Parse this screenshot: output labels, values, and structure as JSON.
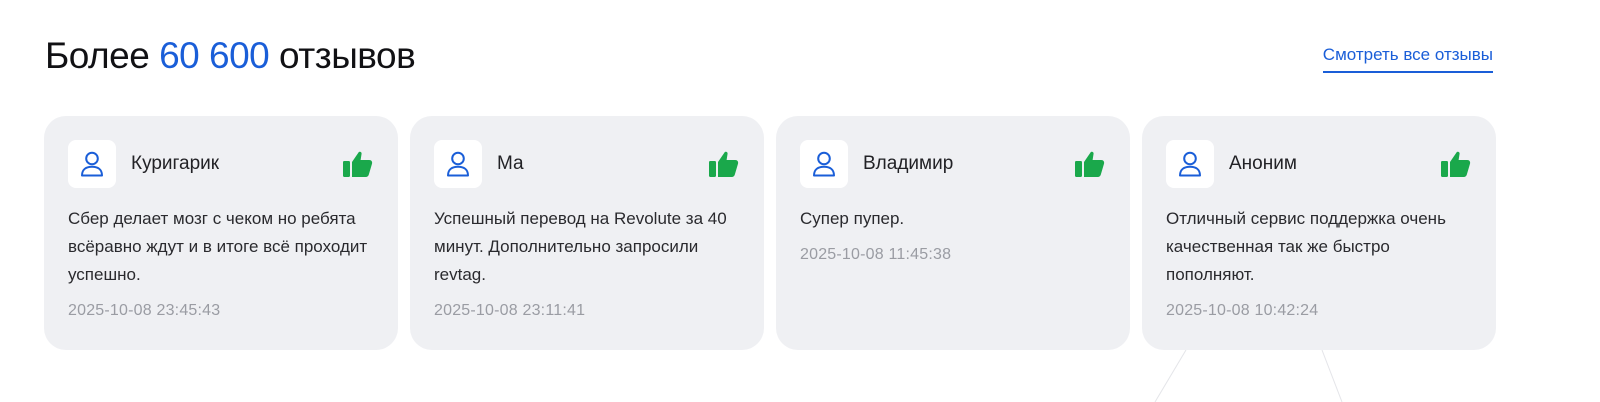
{
  "header": {
    "title_prefix": "Более",
    "title_count": "60 600",
    "title_suffix": "отзывов",
    "see_all_label": "Смотреть все отзывы"
  },
  "colors": {
    "accent": "#1a5ed8",
    "like": "#1aa84b",
    "card_bg": "#eff0f3",
    "date": "#9a9ca3"
  },
  "icons": {
    "avatar": "user-icon",
    "rating": "thumbs-up-icon"
  },
  "reviews": [
    {
      "author": "Куригарик",
      "text": "Сбер делает мозг с чеком но ребята всёравно ждут и в итоге всё проходит успешно.",
      "date": "2025-10-08 23:45:43"
    },
    {
      "author": "Ма",
      "text": "Успешный перевод на Revolute за 40 минут. Дополнительно запросили revtag.",
      "date": "2025-10-08 23:11:41"
    },
    {
      "author": "Владимир",
      "text": "Супер пупер.",
      "date": "2025-10-08 11:45:38"
    },
    {
      "author": "Аноним",
      "text": "Отличный сервис поддержка очень качественная так же быстро пополняют.",
      "date": "2025-10-08 10:42:24"
    }
  ]
}
